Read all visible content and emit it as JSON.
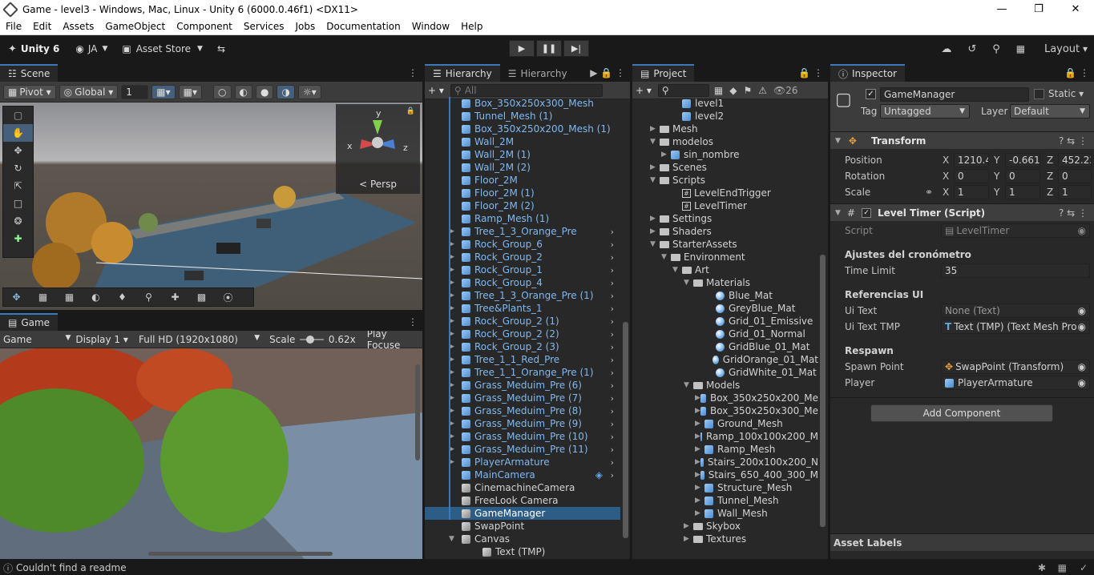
{
  "window": {
    "title": "Game - level3 - Windows, Mac, Linux - Unity 6 (6000.0.46f1) <DX11>"
  },
  "menu": [
    "File",
    "Edit",
    "Assets",
    "GameObject",
    "Component",
    "Services",
    "Jobs",
    "Documentation",
    "Window",
    "Help"
  ],
  "toolbar": {
    "unity_label": "Unity 6",
    "account": "JA",
    "asset_store": "Asset Store",
    "layout": "Layout"
  },
  "scene": {
    "tab": "Scene",
    "pivot": "Pivot",
    "global": "Global",
    "grid_value": "1",
    "persp": "Persp",
    "gizmo_axes": {
      "x": "x",
      "y": "y",
      "z": "z"
    }
  },
  "game": {
    "tab": "Game",
    "mode": "Game",
    "display": "Display 1",
    "resolution": "Full HD (1920x1080)",
    "scale_label": "Scale",
    "scale_value": "0.62x",
    "play_focused": "Play Focuse"
  },
  "hierarchy": {
    "tab1": "Hierarchy",
    "tab2": "Hierarchy",
    "search_placeholder": "All",
    "rows": [
      {
        "name": "Box_350x250x300_Mesh",
        "expand": false,
        "chev": false,
        "plain": false
      },
      {
        "name": "Tunnel_Mesh (1)",
        "expand": false,
        "chev": false,
        "plain": false
      },
      {
        "name": "Box_350x250x200_Mesh (1)",
        "expand": false,
        "chev": false,
        "plain": false
      },
      {
        "name": "Wall_2M",
        "expand": false,
        "chev": false,
        "plain": false
      },
      {
        "name": "Wall_2M (1)",
        "expand": false,
        "chev": false,
        "plain": false
      },
      {
        "name": "Wall_2M (2)",
        "expand": false,
        "chev": false,
        "plain": false
      },
      {
        "name": "Floor_2M",
        "expand": false,
        "chev": false,
        "plain": false
      },
      {
        "name": "Floor_2M (1)",
        "expand": false,
        "chev": false,
        "plain": false
      },
      {
        "name": "Floor_2M (2)",
        "expand": false,
        "chev": false,
        "plain": false
      },
      {
        "name": "Ramp_Mesh (1)",
        "expand": false,
        "chev": false,
        "plain": false
      },
      {
        "name": "Tree_1_3_Orange_Pre",
        "expand": true,
        "chev": true,
        "plain": false
      },
      {
        "name": "Rock_Group_6",
        "expand": true,
        "chev": true,
        "plain": false
      },
      {
        "name": "Rock_Group_2",
        "expand": true,
        "chev": true,
        "plain": false
      },
      {
        "name": "Rock_Group_1",
        "expand": true,
        "chev": true,
        "plain": false
      },
      {
        "name": "Rock_Group_4",
        "expand": true,
        "chev": true,
        "plain": false
      },
      {
        "name": "Tree_1_3_Orange_Pre (1)",
        "expand": true,
        "chev": true,
        "plain": false
      },
      {
        "name": "Tree&Plants_1",
        "expand": true,
        "chev": true,
        "plain": false
      },
      {
        "name": "Rock_Group_2 (1)",
        "expand": true,
        "chev": true,
        "plain": false
      },
      {
        "name": "Rock_Group_2 (2)",
        "expand": true,
        "chev": true,
        "plain": false
      },
      {
        "name": "Rock_Group_2 (3)",
        "expand": true,
        "chev": true,
        "plain": false
      },
      {
        "name": "Tree_1_1_Red_Pre",
        "expand": true,
        "chev": true,
        "plain": false
      },
      {
        "name": "Tree_1_1_Orange_Pre (1)",
        "expand": true,
        "chev": true,
        "plain": false
      },
      {
        "name": "Grass_Meduim_Pre (6)",
        "expand": true,
        "chev": true,
        "plain": false
      },
      {
        "name": "Grass_Meduim_Pre (7)",
        "expand": true,
        "chev": true,
        "plain": false
      },
      {
        "name": "Grass_Meduim_Pre (8)",
        "expand": true,
        "chev": true,
        "plain": false
      },
      {
        "name": "Grass_Meduim_Pre (9)",
        "expand": true,
        "chev": true,
        "plain": false
      },
      {
        "name": "Grass_Meduim_Pre (10)",
        "expand": true,
        "chev": true,
        "plain": false
      },
      {
        "name": "Grass_Meduim_Pre (11)",
        "expand": true,
        "chev": true,
        "plain": false
      },
      {
        "name": "PlayerArmature",
        "expand": true,
        "chev": true,
        "plain": false
      },
      {
        "name": "MainCamera",
        "expand": false,
        "chev": true,
        "plain": false
      },
      {
        "name": "CinemachineCamera",
        "expand": false,
        "chev": false,
        "plain": true
      },
      {
        "name": "FreeLook Camera",
        "expand": false,
        "chev": false,
        "plain": true
      },
      {
        "name": "GameManager",
        "expand": false,
        "chev": false,
        "plain": true,
        "selected": true
      },
      {
        "name": "SwapPoint",
        "expand": false,
        "chev": false,
        "plain": true
      },
      {
        "name": "Canvas",
        "expand": true,
        "chev": false,
        "plain": true,
        "open": true
      },
      {
        "name": "Text (TMP)",
        "expand": false,
        "chev": false,
        "plain": true,
        "indent": true
      }
    ]
  },
  "project": {
    "tab": "Project",
    "count": "26",
    "rows": [
      {
        "name": "level1",
        "type": "cube",
        "indent": 3
      },
      {
        "name": "level2",
        "type": "cube",
        "indent": 3
      },
      {
        "name": "Mesh",
        "type": "folder",
        "indent": 1,
        "arrow": "▶"
      },
      {
        "name": "modelos",
        "type": "folder",
        "indent": 1,
        "arrow": "▼"
      },
      {
        "name": "sin_nombre",
        "type": "cube",
        "indent": 2,
        "arrow": "▶"
      },
      {
        "name": "Scenes",
        "type": "folder",
        "indent": 1,
        "arrow": "▶"
      },
      {
        "name": "Scripts",
        "type": "folder",
        "indent": 1,
        "arrow": "▼"
      },
      {
        "name": "LevelEndTrigger",
        "type": "hash",
        "indent": 3
      },
      {
        "name": "LevelTimer",
        "type": "hash",
        "indent": 3
      },
      {
        "name": "Settings",
        "type": "folder",
        "indent": 1,
        "arrow": "▶"
      },
      {
        "name": "Shaders",
        "type": "folder",
        "indent": 1,
        "arrow": "▶"
      },
      {
        "name": "StarterAssets",
        "type": "folder",
        "indent": 1,
        "arrow": "▼"
      },
      {
        "name": "Environment",
        "type": "folder",
        "indent": 2,
        "arrow": "▼"
      },
      {
        "name": "Art",
        "type": "folder",
        "indent": 3,
        "arrow": "▼"
      },
      {
        "name": "Materials",
        "type": "folder",
        "indent": 4,
        "arrow": "▼"
      },
      {
        "name": "Blue_Mat",
        "type": "mat",
        "indent": 6
      },
      {
        "name": "GreyBlue_Mat",
        "type": "mat",
        "indent": 6
      },
      {
        "name": "Grid_01_Emissive",
        "type": "mat",
        "indent": 6
      },
      {
        "name": "Grid_01_Normal",
        "type": "mat",
        "indent": 6
      },
      {
        "name": "GridBlue_01_Mat",
        "type": "mat",
        "indent": 6
      },
      {
        "name": "GridOrange_01_Mat",
        "type": "mat",
        "indent": 6
      },
      {
        "name": "GridWhite_01_Mat",
        "type": "mat",
        "indent": 6
      },
      {
        "name": "Models",
        "type": "folder",
        "indent": 4,
        "arrow": "▼"
      },
      {
        "name": "Box_350x250x200_Me",
        "type": "cube",
        "indent": 5,
        "arrow": "▶"
      },
      {
        "name": "Box_350x250x300_Me",
        "type": "cube",
        "indent": 5,
        "arrow": "▶"
      },
      {
        "name": "Ground_Mesh",
        "type": "cube",
        "indent": 5,
        "arrow": "▶"
      },
      {
        "name": "Ramp_100x100x200_M",
        "type": "cube",
        "indent": 5,
        "arrow": "▶"
      },
      {
        "name": "Ramp_Mesh",
        "type": "cube",
        "indent": 5,
        "arrow": "▶"
      },
      {
        "name": "Stairs_200x100x200_N",
        "type": "cube",
        "indent": 5,
        "arrow": "▶"
      },
      {
        "name": "Stairs_650_400_300_M",
        "type": "cube",
        "indent": 5,
        "arrow": "▶"
      },
      {
        "name": "Structure_Mesh",
        "type": "cube",
        "indent": 5,
        "arrow": "▶"
      },
      {
        "name": "Tunnel_Mesh",
        "type": "cube",
        "indent": 5,
        "arrow": "▶"
      },
      {
        "name": "Wall_Mesh",
        "type": "cube",
        "indent": 5,
        "arrow": "▶"
      },
      {
        "name": "Skybox",
        "type": "folder",
        "indent": 4,
        "arrow": "▶"
      },
      {
        "name": "Textures",
        "type": "folder",
        "indent": 4,
        "arrow": "▶"
      }
    ]
  },
  "inspector": {
    "tab": "Inspector",
    "object_name": "GameManager",
    "static_label": "Static",
    "tag_label": "Tag",
    "tag_value": "Untagged",
    "layer_label": "Layer",
    "layer_value": "Default",
    "transform": {
      "title": "Transform",
      "position_label": "Position",
      "rotation_label": "Rotation",
      "scale_label": "Scale",
      "position": {
        "x": "1210.4(",
        "y": "-0.661'",
        "z": "452.22"
      },
      "rotation": {
        "x": "0",
        "y": "0",
        "z": "0"
      },
      "scale": {
        "x": "1",
        "y": "1",
        "z": "1"
      },
      "axis_x": "X",
      "axis_y": "Y",
      "axis_z": "Z"
    },
    "script_comp": {
      "title": "Level Timer (Script)",
      "script_label": "Script",
      "script_value": "LevelTimer",
      "section1": "Ajustes del cronómetro",
      "time_limit_label": "Time Limit",
      "time_limit_value": "35",
      "section2": "Referencias UI",
      "ui_text_label": "Ui Text",
      "ui_text_value": "None (Text)",
      "ui_text_tmp_label": "Ui Text TMP",
      "ui_text_tmp_value": "Text (TMP) (Text Mesh Pro",
      "section3": "Respawn",
      "spawn_point_label": "Spawn Point",
      "spawn_point_value": "SwapPoint (Transform)",
      "player_label": "Player",
      "player_value": "PlayerArmature"
    },
    "add_component": "Add Component",
    "asset_labels": "Asset Labels"
  },
  "status": {
    "message": "Couldn't find a readme"
  }
}
